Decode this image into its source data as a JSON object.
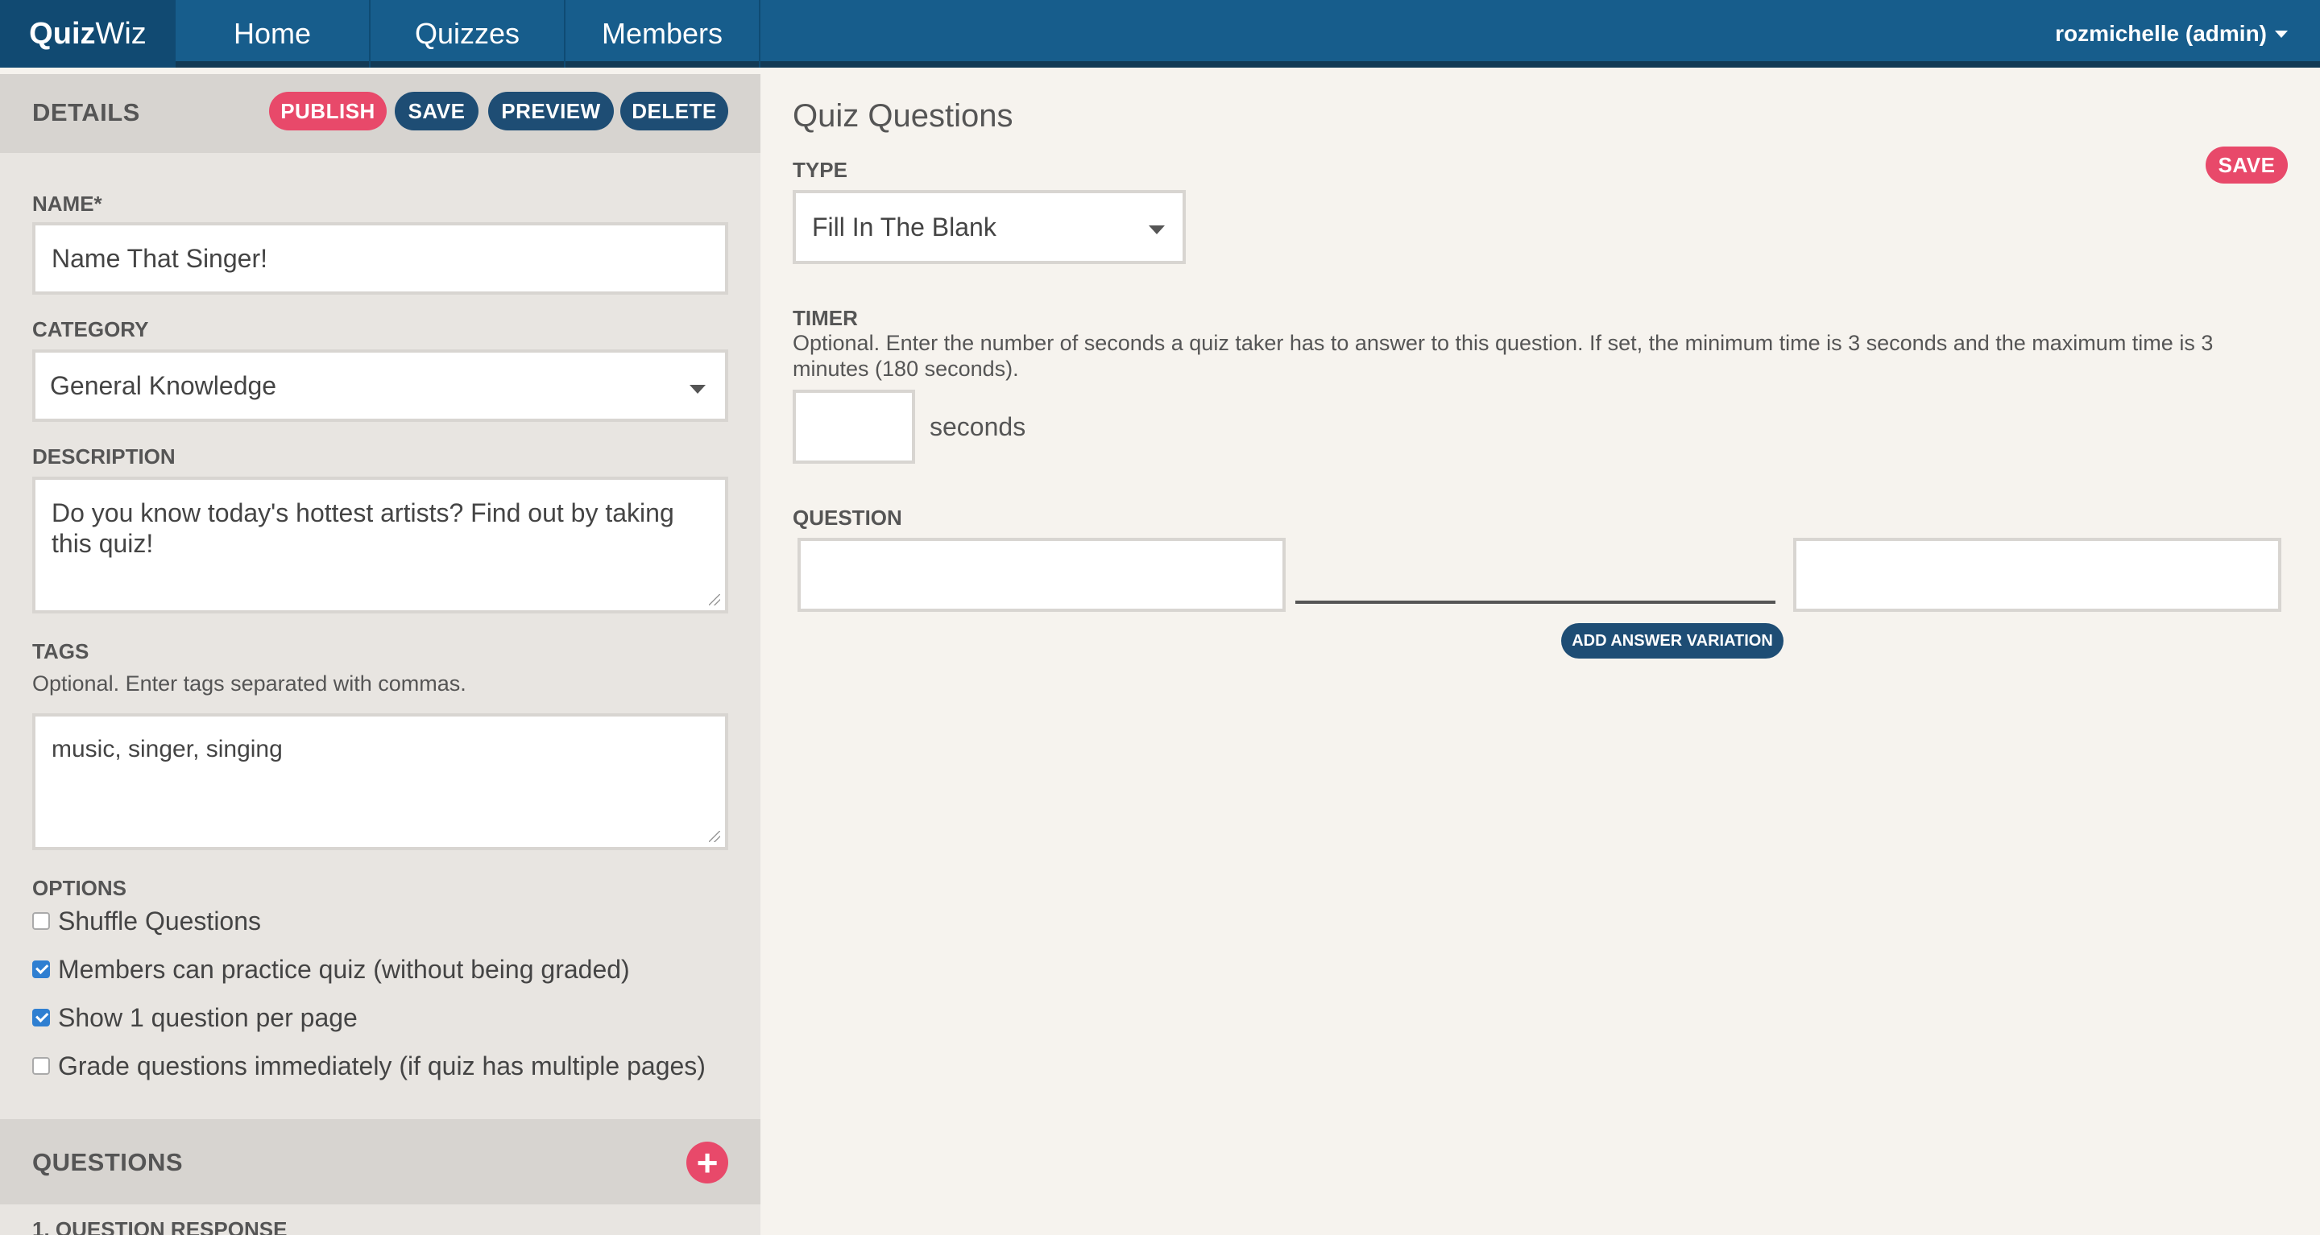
{
  "nav": {
    "brand_bold": "Quiz",
    "brand_rest": "Wiz",
    "links": [
      "Home",
      "Quizzes",
      "Members"
    ],
    "user": "rozmichelle (admin)"
  },
  "details": {
    "title": "DETAILS",
    "buttons": {
      "publish": "PUBLISH",
      "save": "SAVE",
      "preview": "PREVIEW",
      "delete": "DELETE"
    },
    "name_label": "NAME*",
    "name_value": "Name That Singer!",
    "category_label": "CATEGORY",
    "category_value": "General Knowledge",
    "description_label": "DESCRIPTION",
    "description_value": "Do you know today's hottest artists? Find out by taking this quiz!",
    "tags_label": "TAGS",
    "tags_help": "Optional. Enter tags separated with commas.",
    "tags_value": "music, singer, singing",
    "options_label": "OPTIONS",
    "options": [
      {
        "label": "Shuffle Questions",
        "checked": false
      },
      {
        "label": "Members can practice quiz (without being graded)",
        "checked": true
      },
      {
        "label": "Show 1 question per page",
        "checked": true
      },
      {
        "label": "Grade questions immediately (if quiz has multiple pages)",
        "checked": false
      }
    ]
  },
  "questions_section": {
    "title": "QUESTIONS",
    "first_item": "1. QUESTION RESPONSE"
  },
  "quiz_questions": {
    "title": "Quiz Questions",
    "save": "SAVE",
    "type_label": "TYPE",
    "type_value": "Fill In The Blank",
    "timer_label": "TIMER",
    "timer_help": "Optional. Enter the number of seconds a quiz taker has to answer to this question. If set, the minimum time is 3 seconds and the maximum time is 3 minutes (180 seconds).",
    "timer_value": "",
    "seconds_label": "seconds",
    "question_label": "QUESTION",
    "before_value": "",
    "after_value": "",
    "add_variation": "ADD ANSWER VARIATION"
  }
}
